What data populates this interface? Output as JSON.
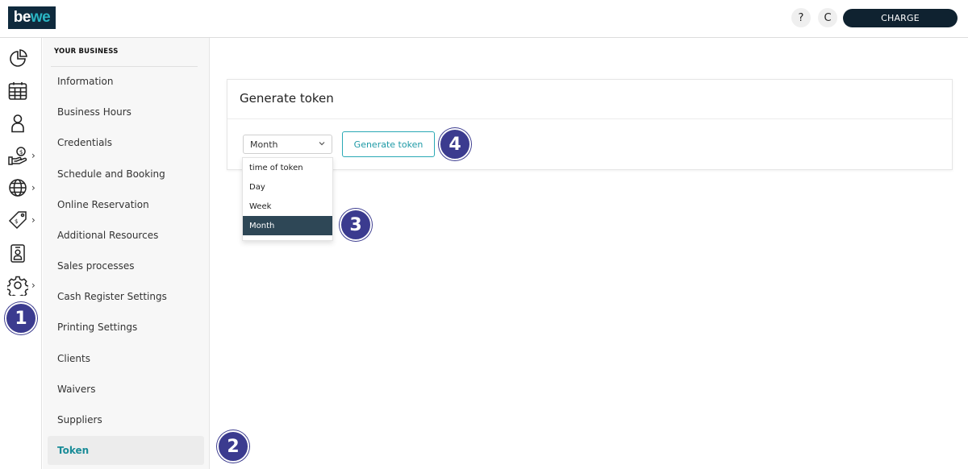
{
  "header": {
    "logo_text_a": "be",
    "logo_text_b": "we",
    "help_label": "?",
    "user_initial": "C",
    "charge_label": "CHARGE"
  },
  "rail": {
    "items": [
      {
        "icon": "pie-chart-icon"
      },
      {
        "icon": "calendar-icon"
      },
      {
        "icon": "user-icon"
      },
      {
        "icon": "money-hand-icon",
        "chevron": "›"
      },
      {
        "icon": "globe-icon",
        "chevron": "›"
      },
      {
        "icon": "price-tag-icon",
        "chevron": "›"
      },
      {
        "icon": "badge-id-icon"
      },
      {
        "icon": "gear-icon",
        "chevron": "›"
      }
    ]
  },
  "subnav": {
    "title": "YOUR BUSINESS",
    "items": [
      {
        "label": "Information"
      },
      {
        "label": "Business Hours"
      },
      {
        "label": "Credentials"
      },
      {
        "label": "Schedule and Booking"
      },
      {
        "label": "Online Reservation"
      },
      {
        "label": "Additional Resources"
      },
      {
        "label": "Sales processes"
      },
      {
        "label": "Cash Register Settings"
      },
      {
        "label": "Printing Settings"
      },
      {
        "label": "Clients"
      },
      {
        "label": "Waivers"
      },
      {
        "label": "Suppliers"
      },
      {
        "label": "Token",
        "active": true
      }
    ]
  },
  "card": {
    "title": "Generate token",
    "select_value": "Month",
    "button_label": "Generate token"
  },
  "dropdown": {
    "options": [
      {
        "label": "time of token"
      },
      {
        "label": "Day"
      },
      {
        "label": "Week"
      },
      {
        "label": "Month",
        "selected": true
      }
    ]
  },
  "annotations": {
    "step1": "1",
    "step2": "2",
    "step3": "3",
    "step4": "4"
  },
  "colors": {
    "brand_dark": "#0f2a3d",
    "accent_teal": "#2aa9b5",
    "badge": "#3b3b8f",
    "selected_option": "#2e4756"
  }
}
